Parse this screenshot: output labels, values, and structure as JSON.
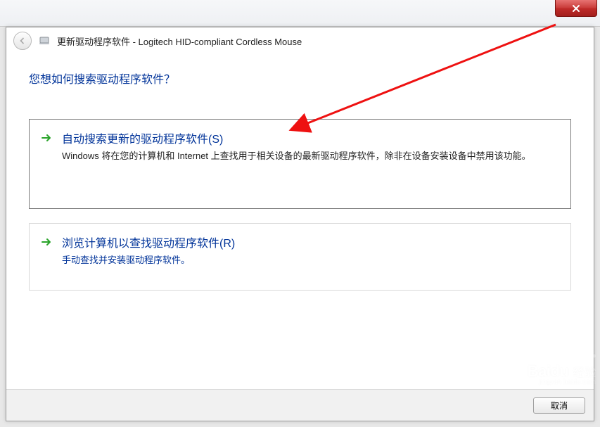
{
  "titlebar": {
    "close_label": "X"
  },
  "header": {
    "title": "更新驱动程序软件 - Logitech HID-compliant Cordless Mouse"
  },
  "body": {
    "question": "您想如何搜索驱动程序软件？",
    "options": [
      {
        "title": "自动搜索更新的驱动程序软件(S)",
        "description": "Windows 将在您的计算机和 Internet 上查找用于相关设备的最新驱动程序软件，除非在设备安装设备中禁用该功能。"
      },
      {
        "title": "浏览计算机以查找驱动程序软件(R)",
        "description": "手动查找并安装驱动程序软件。"
      }
    ]
  },
  "footer": {
    "cancel_label": "取消"
  },
  "watermark": {
    "brand": "Baidu",
    "brand_cn": "经验",
    "url": "jingyan.baidu.com"
  }
}
